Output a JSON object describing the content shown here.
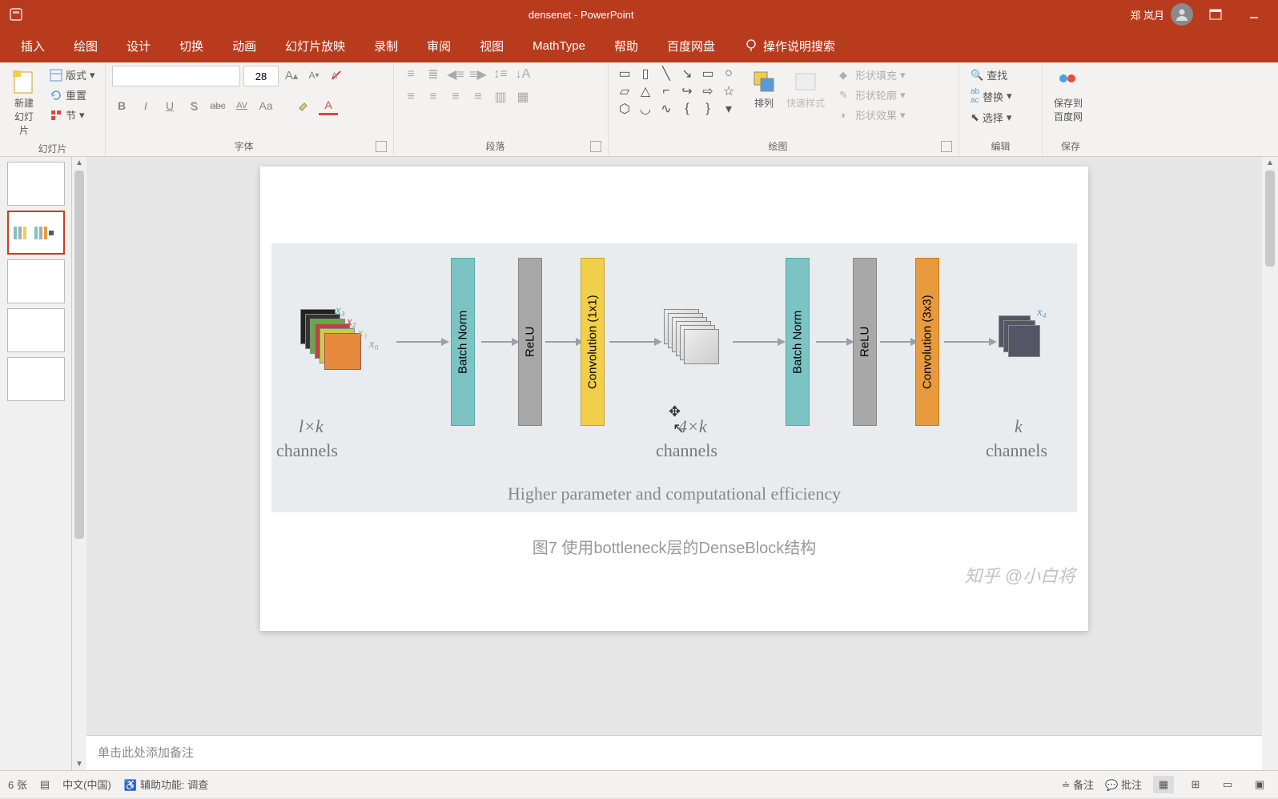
{
  "title_bar": {
    "document_title": "densenet - PowerPoint",
    "user_name": "郑 岚月"
  },
  "ribbon_tabs": [
    "插入",
    "绘图",
    "设计",
    "切换",
    "动画",
    "幻灯片放映",
    "录制",
    "审阅",
    "视图",
    "MathType",
    "帮助",
    "百度网盘"
  ],
  "tell_me": "操作说明搜索",
  "ribbon": {
    "slides": {
      "label": "幻灯片",
      "new_slide": "新建\n幻灯片",
      "layout": "版式",
      "reset": "重置",
      "section": "节"
    },
    "font": {
      "label": "字体",
      "size": "28",
      "bold": "B",
      "italic": "I",
      "underline": "U",
      "shadow": "S",
      "strike": "abc",
      "spacing": "AV",
      "case": "Aa",
      "clear": "A"
    },
    "paragraph": {
      "label": "段落"
    },
    "drawing": {
      "label": "绘图",
      "arrange": "排列",
      "quick_styles": "快速样式",
      "shape_fill": "形状填充",
      "shape_outline": "形状轮廓",
      "shape_effects": "形状效果"
    },
    "editing": {
      "label": "编辑",
      "find": "查找",
      "replace": "替换",
      "select": "选择"
    },
    "save": {
      "label": "保存",
      "save_to": "保存到\n百度网"
    }
  },
  "slide": {
    "blocks": {
      "bn1": "Batch Norm",
      "relu1": "ReLU",
      "conv1": "Convolution (1x1)",
      "bn2": "Batch Norm",
      "relu2": "ReLU",
      "conv3": "Convolution (3x3)"
    },
    "inputs": {
      "x0": "x₀",
      "x1": "x₁",
      "x2": "x₂",
      "x3": "x₃",
      "x4": "x₄"
    },
    "channels": {
      "left_formula": "l×k",
      "left_label": "channels",
      "mid_formula": "4×k",
      "mid_label": "channels",
      "right_formula": "k",
      "right_label": "channels"
    },
    "caption": "Higher parameter and computational efficiency",
    "subcaption": "图7 使用bottleneck层的DenseBlock结构",
    "watermark": "知乎 @小白将"
  },
  "notes_placeholder": "单击此处添加备注",
  "status": {
    "slide_count": "6 张",
    "language": "中文(中国)",
    "accessibility": "辅助功能: 调查",
    "notes_btn": "备注",
    "comments_btn": "批注"
  }
}
